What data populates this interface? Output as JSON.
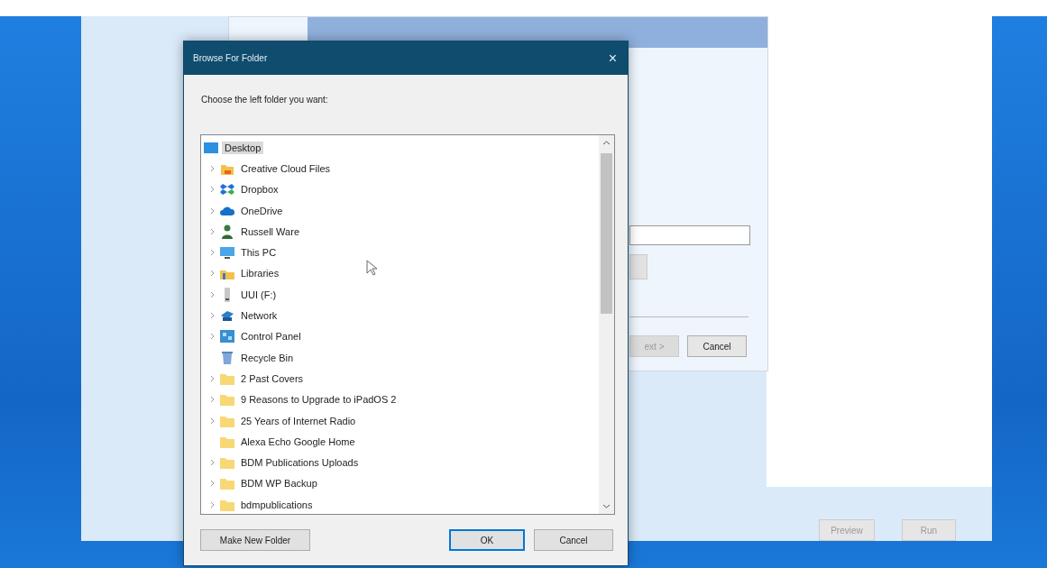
{
  "background_app": {
    "buttons": [
      {
        "label": "Preview",
        "disabled": true
      },
      {
        "label": "Run",
        "disabled": true
      }
    ]
  },
  "wizard": {
    "next_button": {
      "label": "ext >",
      "disabled": true
    },
    "cancel_button": {
      "label": "Cancel"
    }
  },
  "dialog": {
    "title": "Browse For Folder",
    "close": "×",
    "prompt": "Choose the left folder you want:",
    "tree": [
      {
        "label": "Desktop",
        "kind": "desktop",
        "selected": true,
        "children": [
          {
            "label": "Creative Cloud Files",
            "kind": "cloud-folder",
            "expandable": true,
            "selected": false
          },
          {
            "label": "Dropbox",
            "kind": "dropbox",
            "expandable": true,
            "selected": false
          },
          {
            "label": "OneDrive",
            "kind": "cloud",
            "expandable": true,
            "selected": false
          },
          {
            "label": "Russell Ware",
            "kind": "user",
            "expandable": true,
            "selected": false
          },
          {
            "label": "This PC",
            "kind": "pc",
            "expandable": true,
            "selected": false
          },
          {
            "label": "Libraries",
            "kind": "library",
            "expandable": true,
            "selected": false
          },
          {
            "label": "UUI (F:)",
            "kind": "drive",
            "expandable": true,
            "selected": false
          },
          {
            "label": "Network",
            "kind": "network",
            "expandable": true,
            "selected": false
          },
          {
            "label": "Control Panel",
            "kind": "control-panel",
            "expandable": true,
            "selected": false
          },
          {
            "label": "Recycle Bin",
            "kind": "recycle-bin",
            "expandable": false,
            "selected": false
          },
          {
            "label": "2 Past Covers",
            "kind": "folder",
            "expandable": true,
            "selected": false
          },
          {
            "label": "9 Reasons to Upgrade to iPadOS 2",
            "kind": "folder",
            "expandable": true,
            "selected": false
          },
          {
            "label": "25 Years of Internet Radio",
            "kind": "folder",
            "expandable": true,
            "selected": false
          },
          {
            "label": "Alexa Echo Google Home",
            "kind": "folder",
            "expandable": false,
            "selected": false
          },
          {
            "label": "BDM Publications Uploads",
            "kind": "folder",
            "expandable": true,
            "selected": false
          },
          {
            "label": "BDM WP Backup",
            "kind": "folder",
            "expandable": true,
            "selected": false
          },
          {
            "label": "bdmpublications",
            "kind": "folder",
            "expandable": true,
            "selected": false
          }
        ]
      }
    ],
    "buttons": [
      {
        "label": "Make New Folder",
        "focused": false
      },
      {
        "label": "OK",
        "focused": true
      },
      {
        "label": "Cancel",
        "focused": false
      }
    ]
  }
}
